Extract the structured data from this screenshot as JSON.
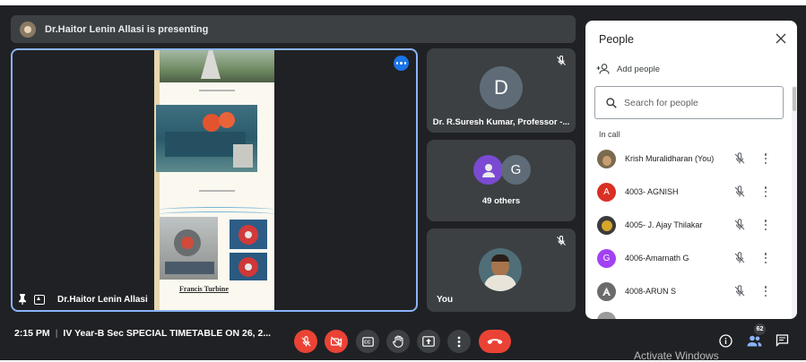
{
  "presenting_bar": {
    "text": "Dr.Haitor Lenin Allasi is presenting"
  },
  "main_tile": {
    "name": "Dr.Haitor Lenin Allasi",
    "slide_caption": "Francis Turbine"
  },
  "side_tiles": [
    {
      "initial": "D",
      "name": "Dr. R.Suresh Kumar, Professor -...",
      "color": "#5f6c78"
    },
    {
      "others_label": "49 others",
      "initial": "G",
      "color": "#5f6c78"
    },
    {
      "name": "You"
    }
  ],
  "bottom_bar": {
    "time": "2:15 PM",
    "separator": "|",
    "meeting_title": "IV Year-B Sec SPECIAL TIMETABLE ON 26, 2...",
    "people_count": "62",
    "activate_windows": "Activate Windows"
  },
  "people_panel": {
    "title": "People",
    "add_people": "Add people",
    "search_placeholder": "Search for people",
    "in_call_label": "In call",
    "participants": [
      {
        "name": "Krish Muralidharan (You)",
        "initial": "",
        "avatar": "photo",
        "color": "#7a6a4f"
      },
      {
        "name": "4003- AGNISH",
        "initial": "A",
        "avatar": "letter",
        "color": "#d93025"
      },
      {
        "name": "4005- J. Ajay Thilakar",
        "initial": "",
        "avatar": "photo",
        "color": "#3b3b3b"
      },
      {
        "name": "4006-Amarnath G",
        "initial": "G",
        "avatar": "letter",
        "color": "#a142f4"
      },
      {
        "name": "4008-ARUN S",
        "initial": "",
        "avatar": "photo",
        "color": "#6b6b6b"
      }
    ]
  },
  "colors": {
    "accent": "#1a73e8",
    "danger": "#ea4335",
    "tile_border": "#8ab4f8",
    "surface": "#202124",
    "tile": "#3c4043"
  },
  "icons": [
    "microphone-off-icon",
    "camera-off-icon",
    "closed-caption-icon",
    "raise-hand-icon",
    "present-screen-icon",
    "more-options-icon",
    "end-call-icon",
    "info-icon",
    "people-icon",
    "chat-icon",
    "close-icon",
    "add-person-icon",
    "search-icon",
    "pin-icon"
  ]
}
